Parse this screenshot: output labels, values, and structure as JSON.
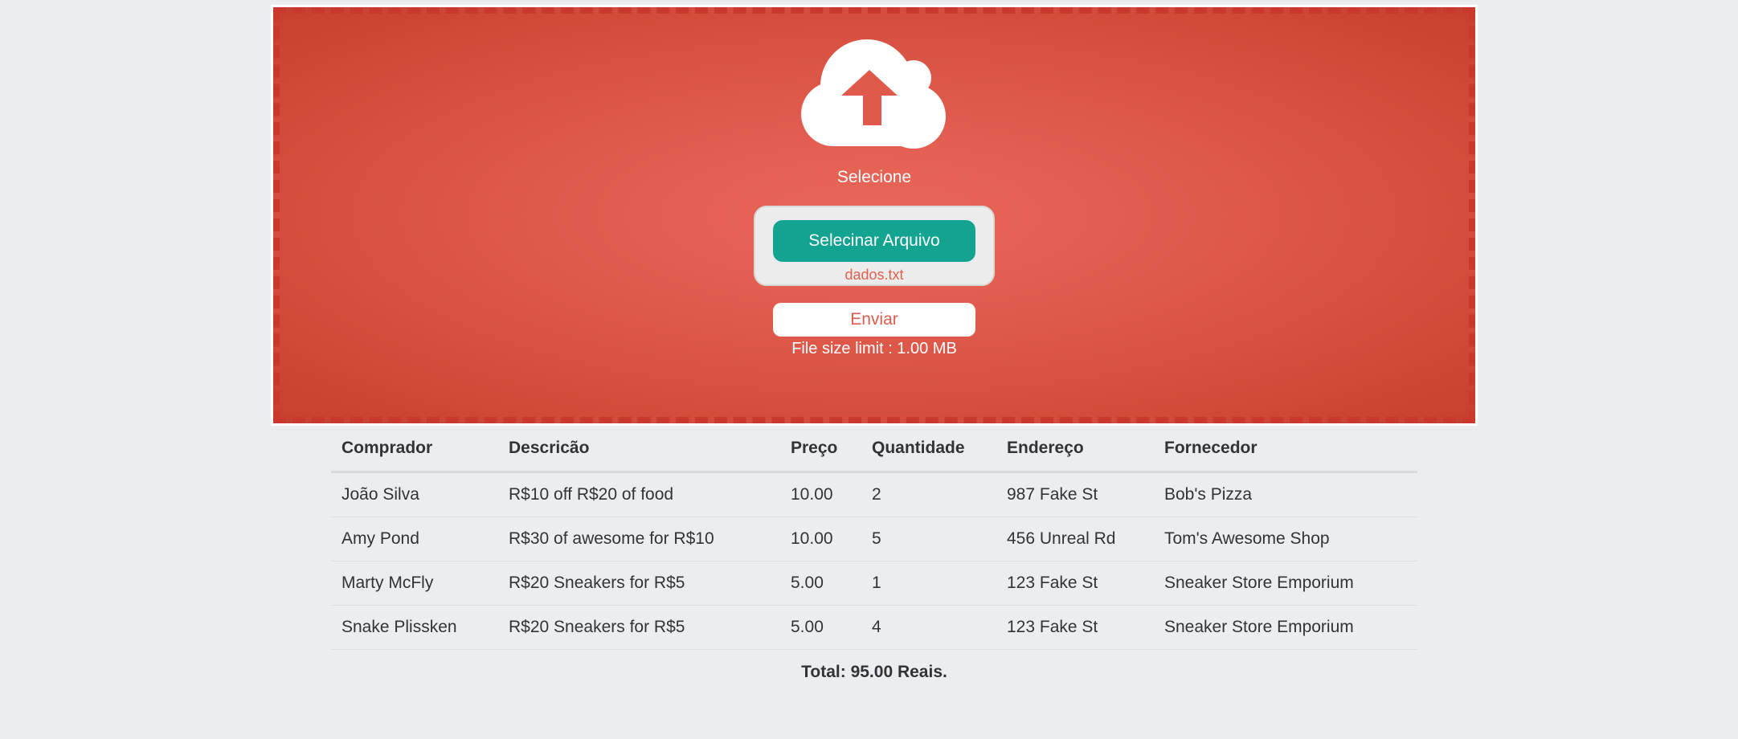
{
  "upload": {
    "prompt": "Selecione",
    "select_button_label": "Selecinar Arquivo",
    "selected_file": "dados.txt",
    "send_button_label": "Enviar",
    "size_limit": "File size limit : 1.00 MB",
    "icon": "cloud-upload-icon",
    "colors": {
      "accent_red": "#e05a4c",
      "border_red": "#c9392b",
      "button_teal": "#12a391"
    }
  },
  "table": {
    "headers": [
      "Comprador",
      "Descricão",
      "Preço",
      "Quantidade",
      "Endereço",
      "Fornecedor"
    ],
    "rows": [
      [
        "João Silva",
        "R$10 off R$20 of food",
        "10.00",
        "2",
        "987 Fake St",
        "Bob's Pizza"
      ],
      [
        "Amy Pond",
        "R$30 of awesome for R$10",
        "10.00",
        "5",
        "456 Unreal Rd",
        "Tom's Awesome Shop"
      ],
      [
        "Marty McFly",
        "R$20 Sneakers for R$5",
        "5.00",
        "1",
        "123 Fake St",
        "Sneaker Store Emporium"
      ],
      [
        "Snake Plissken",
        "R$20 Sneakers for R$5",
        "5.00",
        "4",
        "123 Fake St",
        "Sneaker Store Emporium"
      ]
    ],
    "total": "Total: 95.00 Reais."
  }
}
